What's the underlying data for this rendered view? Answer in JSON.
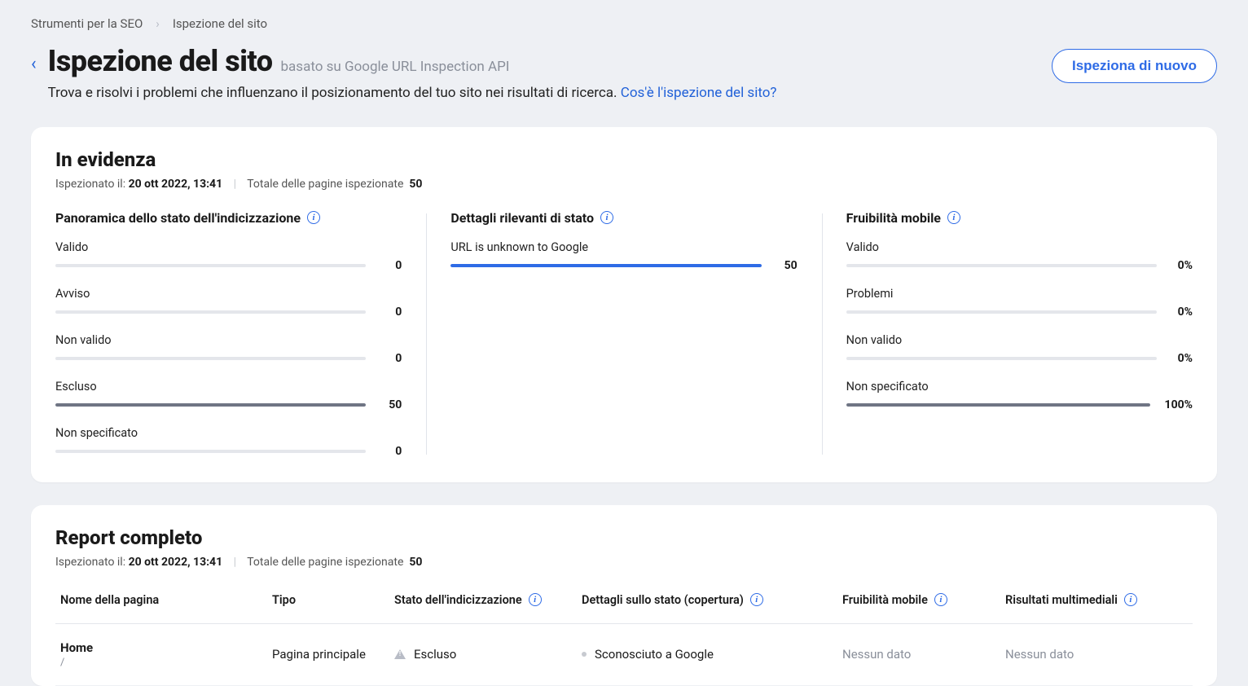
{
  "breadcrumb": {
    "items": [
      "Strumenti per la SEO",
      "Ispezione del sito"
    ]
  },
  "header": {
    "title": "Ispezione del sito",
    "api_note": "basato su Google URL Inspection API",
    "description": "Trova e risolvi i problemi che influenzano il posizionamento del tuo sito nei risultati di ricerca.",
    "help_link": "Cos'è l'ispezione del sito?",
    "reinspect_button": "Ispeziona di nuovo"
  },
  "highlights": {
    "title": "In evidenza",
    "inspected_label": "Ispezionato il:",
    "inspected_at": "20 ott 2022, 13:41",
    "total_label": "Totale delle pagine ispezionate",
    "total_pages": "50",
    "widget_index": {
      "title": "Panoramica dello stato dell'indicizzazione",
      "rows": [
        {
          "label": "Valido",
          "value": "0",
          "pct": 0,
          "color": "#6f7584"
        },
        {
          "label": "Avviso",
          "value": "0",
          "pct": 0,
          "color": "#6f7584"
        },
        {
          "label": "Non valido",
          "value": "0",
          "pct": 0,
          "color": "#6f7584"
        },
        {
          "label": "Escluso",
          "value": "50",
          "pct": 100,
          "color": "#6f7584"
        },
        {
          "label": "Non specificato",
          "value": "0",
          "pct": 0,
          "color": "#6f7584"
        }
      ]
    },
    "widget_status": {
      "title": "Dettagli rilevanti di stato",
      "rows": [
        {
          "label": "URL is unknown to Google",
          "value": "50",
          "pct": 100,
          "color": "#2e6be6"
        }
      ]
    },
    "widget_mobile": {
      "title": "Fruibilità mobile",
      "rows": [
        {
          "label": "Valido",
          "value": "0%",
          "pct": 0,
          "color": "#6f7584"
        },
        {
          "label": "Problemi",
          "value": "0%",
          "pct": 0,
          "color": "#6f7584"
        },
        {
          "label": "Non valido",
          "value": "0%",
          "pct": 0,
          "color": "#6f7584"
        },
        {
          "label": "Non specificato",
          "value": "100%",
          "pct": 100,
          "color": "#6f7584"
        }
      ]
    }
  },
  "report": {
    "title": "Report completo",
    "inspected_label": "Ispezionato il:",
    "inspected_at": "20 ott 2022, 13:41",
    "total_label": "Totale delle pagine ispezionate",
    "total_pages": "50",
    "columns": {
      "page_name": "Nome della pagina",
      "type": "Tipo",
      "index_status": "Stato dell'indicizzazione",
      "coverage_details": "Dettagli sullo stato (copertura)",
      "mobile": "Fruibilità mobile",
      "rich": "Risultati multimediali"
    },
    "rows": [
      {
        "name": "Home",
        "path": "/",
        "type": "Pagina principale",
        "index_status": "Escluso",
        "coverage": "Sconosciuto a Google",
        "mobile": "Nessun dato",
        "rich": "Nessun dato"
      }
    ]
  },
  "chart_data": [
    {
      "type": "bar",
      "title": "Panoramica dello stato dell'indicizzazione",
      "categories": [
        "Valido",
        "Avviso",
        "Non valido",
        "Escluso",
        "Non specificato"
      ],
      "values": [
        0,
        0,
        0,
        50,
        0
      ],
      "ylim": [
        0,
        50
      ]
    },
    {
      "type": "bar",
      "title": "Dettagli rilevanti di stato",
      "categories": [
        "URL is unknown to Google"
      ],
      "values": [
        50
      ],
      "ylim": [
        0,
        50
      ]
    },
    {
      "type": "bar",
      "title": "Fruibilità mobile",
      "categories": [
        "Valido",
        "Problemi",
        "Non valido",
        "Non specificato"
      ],
      "values": [
        0,
        0,
        0,
        100
      ],
      "ylabel": "%",
      "ylim": [
        0,
        100
      ]
    }
  ]
}
